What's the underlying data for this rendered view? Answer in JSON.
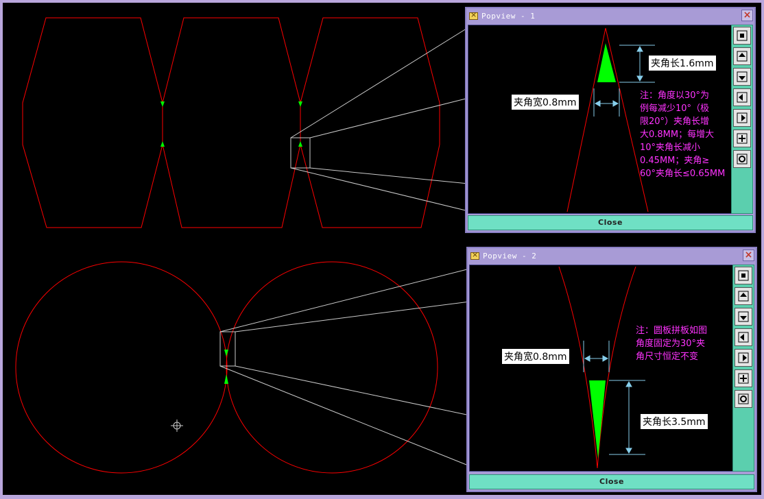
{
  "colors": {
    "background": "#000000",
    "outline": "#ff0000",
    "fill": "#00ff00",
    "leader": "#cccccc",
    "dimension": "#87ceeb",
    "note": "#ff33ff",
    "toolbar": "#5bcfae",
    "frame": "#a89bd6"
  },
  "popview1": {
    "title": "Popview - 1",
    "length_label": "夹角长1.6mm",
    "width_label": "夹角宽0.8mm",
    "note_lines": [
      "注：角度以30°为",
      "例每减少10°（极",
      "限20°）夹角长增",
      "大0.8MM；每增大",
      "10°夹角长减小",
      "0.45MM；夹角≥",
      "60°夹角长≤0.65MM"
    ],
    "close_label": "Close"
  },
  "popview2": {
    "title": "Popview - 2",
    "width_label": "夹角宽0.8mm",
    "length_label": "夹角长3.5mm",
    "note_lines": [
      "注：圆板拼板如图",
      "角度固定为30°夹",
      "角尺寸恒定不变"
    ],
    "close_label": "Close"
  },
  "toolbar_icons": [
    "zoom-window-icon",
    "pan-up-icon",
    "pan-down-icon",
    "pan-left-icon",
    "pan-right-icon",
    "zoom-in-icon",
    "zoom-out-icon"
  ]
}
